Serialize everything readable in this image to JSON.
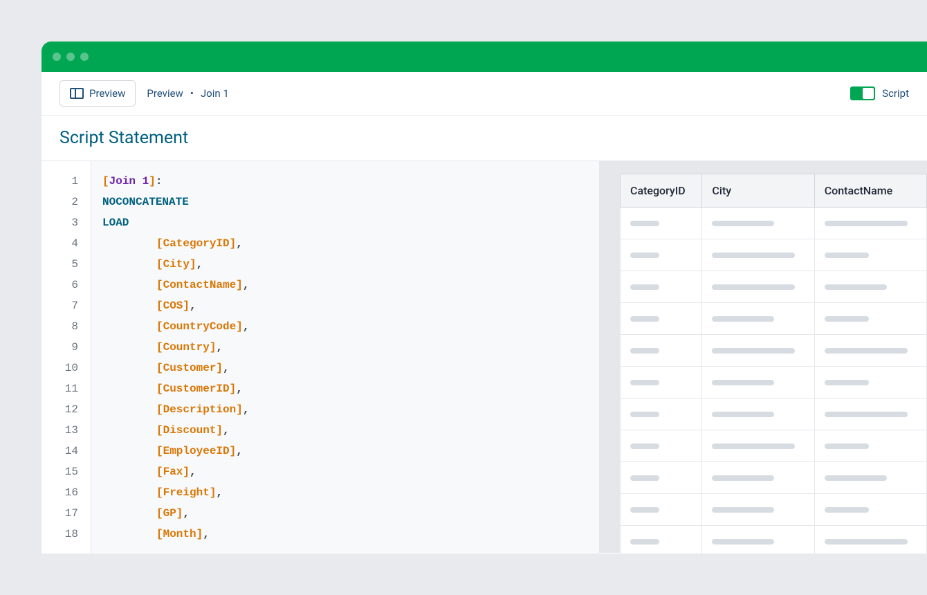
{
  "window": {
    "accent_color": "#00a651"
  },
  "toolbar": {
    "preview_button_label": "Preview",
    "breadcrumb": [
      "Preview",
      "Join 1"
    ],
    "toggle_label": "Script",
    "toggle_on": true
  },
  "section": {
    "title": "Script Statement"
  },
  "editor": {
    "line_count": 18,
    "lines": [
      {
        "tokens": [
          {
            "type": "bracket",
            "text": "["
          },
          {
            "type": "label",
            "text": "Join 1"
          },
          {
            "type": "bracket",
            "text": "]"
          },
          {
            "type": "text",
            "text": ":"
          }
        ]
      },
      {
        "tokens": [
          {
            "type": "keyword",
            "text": "NOCONCATENATE"
          }
        ]
      },
      {
        "tokens": [
          {
            "type": "keyword",
            "text": "LOAD"
          }
        ]
      },
      {
        "indent": 1,
        "tokens": [
          {
            "type": "field",
            "text": "[CategoryID]"
          },
          {
            "type": "comma",
            "text": ","
          }
        ]
      },
      {
        "indent": 1,
        "tokens": [
          {
            "type": "field",
            "text": "[City]"
          },
          {
            "type": "comma",
            "text": ","
          }
        ]
      },
      {
        "indent": 1,
        "tokens": [
          {
            "type": "field",
            "text": "[ContactName]"
          },
          {
            "type": "comma",
            "text": ","
          }
        ]
      },
      {
        "indent": 1,
        "tokens": [
          {
            "type": "field",
            "text": "[COS]"
          },
          {
            "type": "comma",
            "text": ","
          }
        ]
      },
      {
        "indent": 1,
        "tokens": [
          {
            "type": "field",
            "text": "[CountryCode]"
          },
          {
            "type": "comma",
            "text": ","
          }
        ]
      },
      {
        "indent": 1,
        "tokens": [
          {
            "type": "field",
            "text": "[Country]"
          },
          {
            "type": "comma",
            "text": ","
          }
        ]
      },
      {
        "indent": 1,
        "tokens": [
          {
            "type": "field",
            "text": "[Customer]"
          },
          {
            "type": "comma",
            "text": ","
          }
        ]
      },
      {
        "indent": 1,
        "tokens": [
          {
            "type": "field",
            "text": "[CustomerID]"
          },
          {
            "type": "comma",
            "text": ","
          }
        ]
      },
      {
        "indent": 1,
        "tokens": [
          {
            "type": "field",
            "text": "[Description]"
          },
          {
            "type": "comma",
            "text": ","
          }
        ]
      },
      {
        "indent": 1,
        "tokens": [
          {
            "type": "field",
            "text": "[Discount]"
          },
          {
            "type": "comma",
            "text": ","
          }
        ]
      },
      {
        "indent": 1,
        "tokens": [
          {
            "type": "field",
            "text": "[EmployeeID]"
          },
          {
            "type": "comma",
            "text": ","
          }
        ]
      },
      {
        "indent": 1,
        "tokens": [
          {
            "type": "field",
            "text": "[Fax]"
          },
          {
            "type": "comma",
            "text": ","
          }
        ]
      },
      {
        "indent": 1,
        "tokens": [
          {
            "type": "field",
            "text": "[Freight]"
          },
          {
            "type": "comma",
            "text": ","
          }
        ]
      },
      {
        "indent": 1,
        "tokens": [
          {
            "type": "field",
            "text": "[GP]"
          },
          {
            "type": "comma",
            "text": ","
          }
        ]
      },
      {
        "indent": 1,
        "tokens": [
          {
            "type": "field",
            "text": "[Month]"
          },
          {
            "type": "comma",
            "text": ","
          }
        ]
      }
    ]
  },
  "preview_table": {
    "columns": [
      "CategoryID",
      "City",
      "ContactName"
    ],
    "row_count": 11,
    "placeholder_widths": {
      "col0": [
        "short",
        "short",
        "short",
        "short",
        "short",
        "short",
        "short",
        "short",
        "short",
        "short",
        "short"
      ],
      "col1": [
        "medium",
        "long",
        "long",
        "medium",
        "long",
        "medium",
        "medium",
        "long",
        "medium",
        "medium",
        "medium"
      ],
      "col2": [
        "long",
        "medium-short",
        "medium",
        "medium-short",
        "long",
        "medium-short",
        "long",
        "medium-short",
        "medium",
        "medium-short",
        "long"
      ]
    }
  }
}
